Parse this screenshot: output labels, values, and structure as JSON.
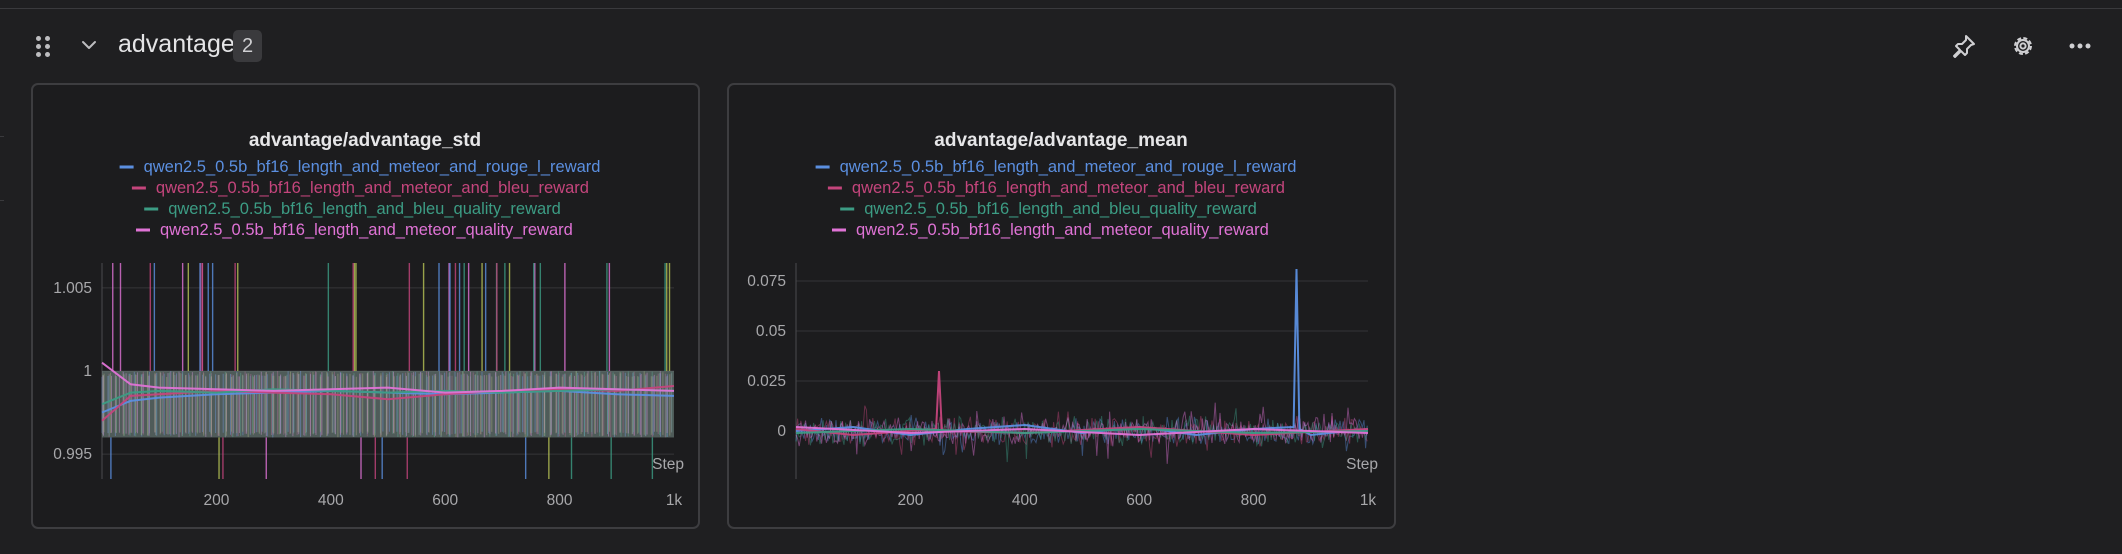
{
  "section": {
    "title": "advantage",
    "count": "2"
  },
  "icons": {
    "drag": "drag-handle-icon",
    "collapse": "chevron-down-icon",
    "pin": "pin-icon",
    "settings": "gear-icon",
    "more": "more-horizontal-icon"
  },
  "chart_data": [
    {
      "type": "line",
      "title": "advantage/advantage_std",
      "xlabel": "Step",
      "ylabel": "",
      "x_ticks": [
        "200",
        "400",
        "600",
        "800",
        "1k"
      ],
      "y_ticks": [
        "1.005",
        "1",
        "0.995"
      ],
      "xlim": [
        0,
        1000
      ],
      "ylim": [
        0.9935,
        1.0065
      ],
      "grid": true,
      "legend_position": "top-center",
      "series": [
        {
          "name": "qwen2.5_0.5b_bf16_length_and_meteor_and_rouge_l_reward",
          "color": "#5b8fe0",
          "x": [
            0,
            50,
            100,
            200,
            300,
            400,
            500,
            600,
            700,
            800,
            900,
            1000
          ],
          "values": [
            0.9975,
            0.9982,
            0.9984,
            0.9986,
            0.9987,
            0.9988,
            0.9987,
            0.9986,
            0.9987,
            0.9988,
            0.9986,
            0.9985
          ]
        },
        {
          "name": "qwen2.5_0.5b_bf16_length_and_meteor_and_bleu_reward",
          "color": "#c4457c",
          "x": [
            0,
            50,
            100,
            200,
            300,
            400,
            500,
            600,
            700,
            800,
            900,
            1000
          ],
          "values": [
            0.997,
            0.9985,
            0.9986,
            0.9988,
            0.9987,
            0.9986,
            0.9983,
            0.9986,
            0.9988,
            0.9989,
            0.9988,
            0.9991
          ]
        },
        {
          "name": "qwen2.5_0.5b_bf16_length_and_bleu_quality_reward",
          "color": "#3c9c84",
          "x": [
            0,
            50,
            100,
            200,
            300,
            400,
            500,
            600,
            700,
            800,
            900,
            1000
          ],
          "values": [
            0.998,
            0.9987,
            0.9988,
            0.9987,
            0.9989,
            0.9988,
            0.9987,
            0.9988,
            0.9987,
            0.9988,
            0.9989,
            0.9988
          ]
        },
        {
          "name": "qwen2.5_0.5b_bf16_length_and_meteor_quality_reward",
          "color": "#e073d6",
          "x": [
            0,
            50,
            100,
            200,
            300,
            400,
            500,
            600,
            700,
            800,
            900,
            1000
          ],
          "values": [
            1.0005,
            0.9992,
            0.999,
            0.9989,
            0.9988,
            0.9989,
            0.999,
            0.9987,
            0.9988,
            0.999,
            0.9989,
            0.9988
          ]
        }
      ]
    },
    {
      "type": "line",
      "title": "advantage/advantage_mean",
      "xlabel": "Step",
      "ylabel": "",
      "x_ticks": [
        "200",
        "400",
        "600",
        "800",
        "1k"
      ],
      "y_ticks": [
        "0.075",
        "0.05",
        "0.025",
        "0"
      ],
      "xlim": [
        0,
        1000
      ],
      "ylim": [
        -0.024,
        0.084
      ],
      "grid": true,
      "legend_position": "top-center",
      "series": [
        {
          "name": "qwen2.5_0.5b_bf16_length_and_meteor_and_rouge_l_reward",
          "color": "#5b8fe0",
          "x": [
            0,
            100,
            200,
            300,
            400,
            500,
            600,
            700,
            800,
            870,
            875,
            880,
            900,
            1000
          ],
          "values": [
            0,
            0.002,
            -0.002,
            0.001,
            0.003,
            -0.001,
            0.002,
            -0.002,
            0.001,
            0.002,
            0.081,
            0.001,
            -0.002,
            0.001
          ]
        },
        {
          "name": "qwen2.5_0.5b_bf16_length_and_meteor_and_bleu_reward",
          "color": "#c4457c",
          "x": [
            0,
            100,
            245,
            250,
            255,
            400,
            600,
            800,
            1000
          ],
          "values": [
            0.001,
            -0.002,
            0.001,
            0.03,
            0.0,
            -0.001,
            0.002,
            -0.002,
            0.001
          ]
        },
        {
          "name": "qwen2.5_0.5b_bf16_length_and_bleu_quality_reward",
          "color": "#3c9c84",
          "x": [
            0,
            200,
            400,
            600,
            800,
            1000
          ],
          "values": [
            -0.001,
            0.001,
            -0.001,
            0.001,
            -0.001,
            0.0
          ]
        },
        {
          "name": "qwen2.5_0.5b_bf16_length_and_meteor_quality_reward",
          "color": "#e073d6",
          "x": [
            0,
            200,
            400,
            600,
            800,
            1000
          ],
          "values": [
            0.002,
            -0.001,
            0.001,
            -0.002,
            0.001,
            -0.001
          ]
        }
      ]
    }
  ]
}
